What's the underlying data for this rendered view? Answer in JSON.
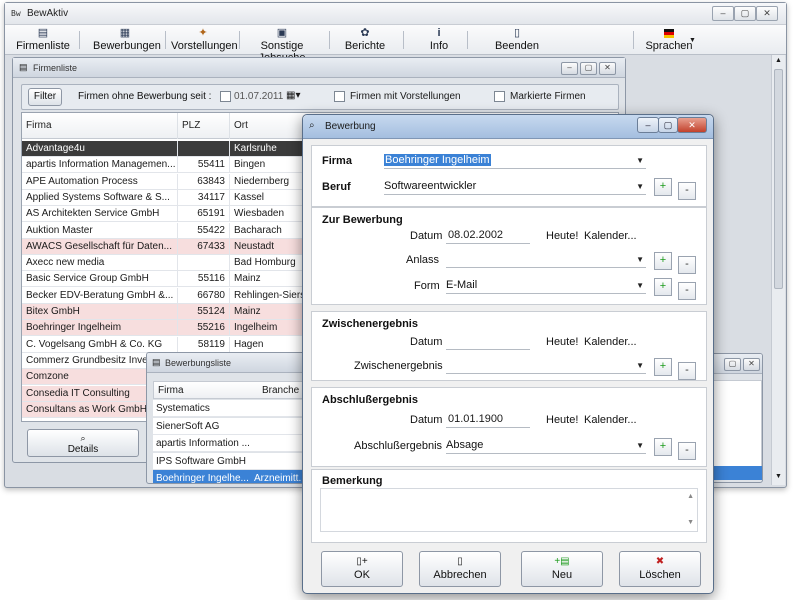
{
  "app": {
    "title": "BewAktiv",
    "icon": "Bw"
  },
  "toolbar": {
    "items": [
      {
        "label": "Firmenliste",
        "icon": "list-icon"
      },
      {
        "label": "Bewerbungen",
        "icon": "folder-icon"
      },
      {
        "label": "Vorstellungen",
        "icon": "people-icon"
      },
      {
        "label": "Sonstige Jobsuche",
        "icon": "search-icon"
      },
      {
        "label": "Berichte",
        "icon": "chart-icon"
      },
      {
        "label": "Info",
        "icon": "info-icon"
      },
      {
        "label": "Beenden",
        "icon": "exit-icon"
      },
      {
        "label": "Sprachen",
        "icon": "flag-icon"
      }
    ]
  },
  "firmenliste": {
    "title": "Firmenliste",
    "filter_label": "Filter",
    "firmen_ohne_label": "Firmen ohne Bewerbung seit :",
    "date_value": "01.07.2011",
    "mit_vorstellungen_label": "Firmen mit Vorstellungen",
    "markierte_label": "Markierte Firmen",
    "columns": {
      "firma": "Firma",
      "plz": "PLZ",
      "ort": "Ort"
    },
    "rows": [
      {
        "firma": "Advantage4u",
        "plz": "",
        "ort": "Karlsruhe",
        "style": "sel"
      },
      {
        "firma": "apartis Information Managemen...",
        "plz": "55411",
        "ort": "Bingen",
        "style": ""
      },
      {
        "firma": "APE Automation Process",
        "plz": "63843",
        "ort": "Niedernberg",
        "style": ""
      },
      {
        "firma": "Applied Systems Software & S...",
        "plz": "34117",
        "ort": "Kassel",
        "style": ""
      },
      {
        "firma": "AS Architekten Service GmbH",
        "plz": "65191",
        "ort": "Wiesbaden",
        "style": ""
      },
      {
        "firma": "Auktion Master",
        "plz": "55422",
        "ort": "Bacharach",
        "style": ""
      },
      {
        "firma": "AWACS Gesellschaft für Daten...",
        "plz": "67433",
        "ort": "Neustadt",
        "style": "pink"
      },
      {
        "firma": "Axecc new media",
        "plz": "",
        "ort": "Bad Homburg",
        "style": ""
      },
      {
        "firma": "Basic Service Group GmbH",
        "plz": "55116",
        "ort": "Mainz",
        "style": ""
      },
      {
        "firma": "Becker EDV-Beratung GmbH &...",
        "plz": "66780",
        "ort": "Rehlingen-Siersburg",
        "style": ""
      },
      {
        "firma": "Bitex GmbH",
        "plz": "55124",
        "ort": "Mainz",
        "style": "pink"
      },
      {
        "firma": "Boehringer Ingelheim",
        "plz": "55216",
        "ort": "Ingelheim",
        "style": "pink"
      },
      {
        "firma": "C. Vogelsang GmbH & Co. KG",
        "plz": "58119",
        "ort": "Hagen",
        "style": ""
      },
      {
        "firma": "Commerz Grundbesitz Inve...",
        "plz": "",
        "ort": "",
        "style": ""
      },
      {
        "firma": "Comzone",
        "plz": "",
        "ort": "",
        "style": "pink"
      },
      {
        "firma": "Consedia IT Consulting",
        "plz": "",
        "ort": "",
        "style": "pink"
      },
      {
        "firma": "Consultans as Work GmbH",
        "plz": "",
        "ort": "",
        "style": "pink"
      }
    ],
    "details_label": "Details"
  },
  "bewerbungsliste": {
    "title": "Bewerbungsliste",
    "columns": {
      "firma": "Firma",
      "branche": "Branche"
    },
    "rows": [
      {
        "firma": "Systematics",
        "branche": ""
      },
      {
        "firma": "SienerSoft AG",
        "branche": ""
      },
      {
        "firma": "apartis Information ...",
        "branche": ""
      },
      {
        "firma": "IPS Software GmbH",
        "branche": ""
      },
      {
        "firma": "Boehringer Ingelhe...",
        "branche": "Arzneimitt..."
      }
    ]
  },
  "dialog": {
    "title": "Bewerbung",
    "firma_label": "Firma",
    "firma_value": "Boehringer Ingelheim",
    "beruf_label": "Beruf",
    "beruf_value": "Softwareentwickler",
    "zur_bewerbung_label": "Zur Bewerbung",
    "datum_label": "Datum",
    "datum_value": "08.02.2002",
    "heute_label": "Heute!",
    "kalender_label": "Kalender...",
    "anlass_label": "Anlass",
    "anlass_value": "",
    "form_label": "Form",
    "form_value": "E-Mail",
    "zwischenergebnis_header": "Zwischenergebnis",
    "zw_datum_value": "",
    "zwischenergebnis_label": "Zwischenergebnis",
    "zwischenergebnis_value": "",
    "abschluss_header": "Abschlußergebnis",
    "ab_datum_value": "01.01.1900",
    "abschluss_label": "Abschlußergebnis",
    "abschluss_value": "Absage",
    "bemerkung_label": "Bemerkung",
    "buttons": {
      "ok": "OK",
      "abbrechen": "Abbrechen",
      "neu": "Neu",
      "loeschen": "Löschen"
    },
    "plus": "+",
    "minus": "-"
  }
}
